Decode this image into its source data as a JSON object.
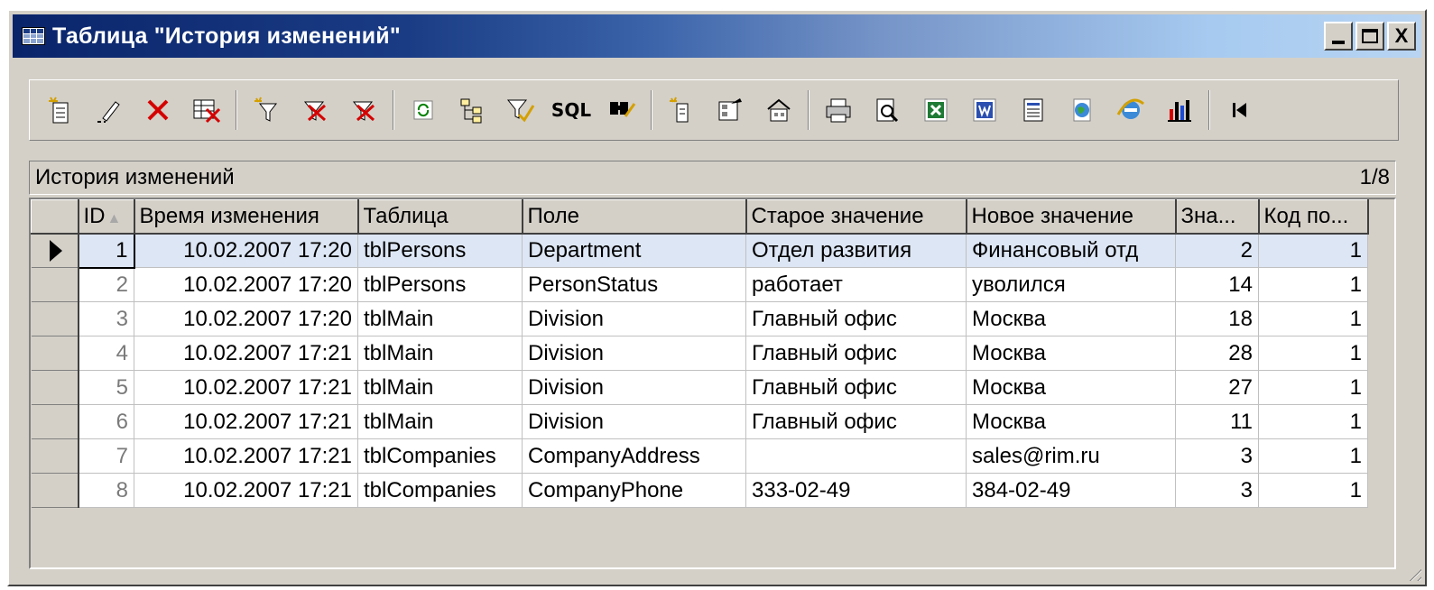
{
  "window": {
    "title": "Таблица \"История изменений\"",
    "buttons": {
      "minimize": "_",
      "maximize": "□",
      "close": "X"
    }
  },
  "toolbar": {
    "icons": [
      "new-record-icon",
      "edit-pencil-icon",
      "delete-x-icon",
      "delete-table-icon",
      "filter-icon",
      "clear-filter-icon",
      "remove-filter-icon",
      "refresh-icon",
      "tree-icon",
      "filter-check-icon",
      "sql-icon",
      "find-icon",
      "new-form-icon",
      "properties-icon",
      "settings-icon",
      "print-icon",
      "print-preview-icon",
      "excel-icon",
      "word-icon",
      "word-doc-icon",
      "globe-icon",
      "internet-explorer-icon",
      "chart-icon",
      "first-record-icon"
    ],
    "sql_label": "SQL"
  },
  "caption": {
    "text": "История изменений",
    "record_position": "1/8"
  },
  "grid": {
    "columns": [
      "ID",
      "Время изменения",
      "Таблица",
      "Поле",
      "Старое значение",
      "Новое значение",
      "Зна...",
      "Код по..."
    ],
    "rows": [
      {
        "id": "1",
        "time": "10.02.2007 17:20",
        "table": "tblPersons",
        "field": "Department",
        "old": "Отдел развития",
        "new": "Финансовый отд",
        "val": "2",
        "code": "1"
      },
      {
        "id": "2",
        "time": "10.02.2007 17:20",
        "table": "tblPersons",
        "field": "PersonStatus",
        "old": "работает",
        "new": "уволился",
        "val": "14",
        "code": "1"
      },
      {
        "id": "3",
        "time": "10.02.2007 17:20",
        "table": "tblMain",
        "field": "Division",
        "old": "Главный офис",
        "new": "Москва",
        "val": "18",
        "code": "1"
      },
      {
        "id": "4",
        "time": "10.02.2007 17:21",
        "table": "tblMain",
        "field": "Division",
        "old": "Главный офис",
        "new": "Москва",
        "val": "28",
        "code": "1"
      },
      {
        "id": "5",
        "time": "10.02.2007 17:21",
        "table": "tblMain",
        "field": "Division",
        "old": "Главный офис",
        "new": "Москва",
        "val": "27",
        "code": "1"
      },
      {
        "id": "6",
        "time": "10.02.2007 17:21",
        "table": "tblMain",
        "field": "Division",
        "old": "Главный офис",
        "new": "Москва",
        "val": "11",
        "code": "1"
      },
      {
        "id": "7",
        "time": "10.02.2007 17:21",
        "table": "tblCompanies",
        "field": "CompanyAddress",
        "old": "",
        "new": "sales@rim.ru",
        "val": "3",
        "code": "1"
      },
      {
        "id": "8",
        "time": "10.02.2007 17:21",
        "table": "tblCompanies",
        "field": "CompanyPhone",
        "old": "333-02-49",
        "new": "384-02-49",
        "val": "3",
        "code": "1"
      }
    ],
    "selected_row": "1"
  },
  "colors": {
    "title_gradient_start": "#0a246a",
    "title_gradient_end": "#b8d4f2",
    "window_face": "#d4d0c8",
    "selected_row": "#dde6f4"
  }
}
